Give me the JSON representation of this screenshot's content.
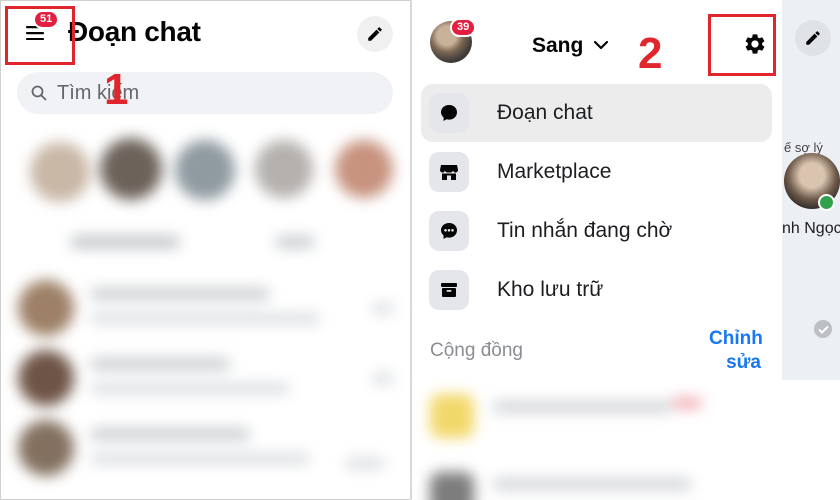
{
  "left_panel": {
    "menu_badge": "51",
    "title": "Đoạn chat",
    "search_placeholder": "Tìm kiếm",
    "step_number": "1"
  },
  "drawer": {
    "notification_badge": "39",
    "account_name": "Sang",
    "step_number": "2",
    "menu_items": [
      {
        "label": "Đoạn chat",
        "icon": "chat-bubble-icon",
        "active": true
      },
      {
        "label": "Marketplace",
        "icon": "storefront-icon",
        "active": false
      },
      {
        "label": "Tin nhắn đang chờ",
        "icon": "pending-message-icon",
        "active": false
      },
      {
        "label": "Kho lưu trữ",
        "icon": "archive-box-icon",
        "active": false
      }
    ],
    "community_section_label": "Cộng đồng",
    "edit_link": "Chỉnh sửa"
  },
  "background_peek": {
    "message_snippet": "ế sợ lý",
    "contact_name": "nh Ngọc"
  },
  "colors": {
    "highlight_box": "#e0262c",
    "badge": "#e41e3f",
    "link": "#1877f2",
    "online": "#31a24c"
  }
}
